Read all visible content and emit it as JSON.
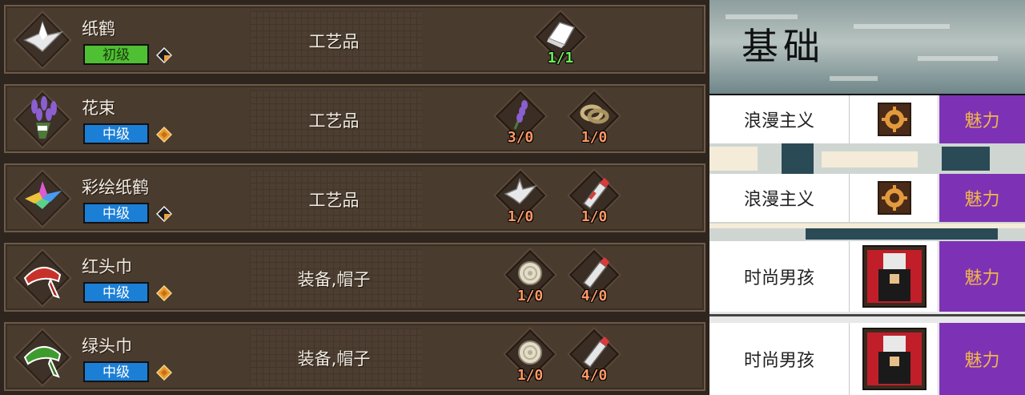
{
  "recipes": [
    {
      "name": "纸鹤",
      "level": "初级",
      "level_type": "basic",
      "category": "工艺品",
      "item_icon": "paper-crane-icon",
      "tag_icon": "black-gold-diamond-icon",
      "materials": [
        {
          "icon": "paper-icon",
          "count": "1/1",
          "ok": true
        }
      ]
    },
    {
      "name": "花束",
      "level": "中级",
      "level_type": "mid",
      "category": "工艺品",
      "item_icon": "lavender-bouquet-icon",
      "tag_icon": "orange-diamond-icon",
      "materials": [
        {
          "icon": "lavender-icon",
          "count": "3/0",
          "ok": false
        },
        {
          "icon": "rope-icon",
          "count": "1/0",
          "ok": false
        }
      ]
    },
    {
      "name": "彩绘纸鹤",
      "level": "中级",
      "level_type": "mid",
      "category": "工艺品",
      "item_icon": "rainbow-crane-icon",
      "tag_icon": "black-gold-diamond-icon",
      "materials": [
        {
          "icon": "paper-crane-icon",
          "count": "1/0",
          "ok": false
        },
        {
          "icon": "paint-tube-icon",
          "count": "1/0",
          "ok": false
        }
      ]
    },
    {
      "name": "红头巾",
      "level": "中级",
      "level_type": "mid",
      "category": "装备,帽子",
      "item_icon": "red-bandana-icon",
      "tag_icon": "orange-diamond-icon",
      "materials": [
        {
          "icon": "cloth-roll-icon",
          "count": "1/0",
          "ok": false
        },
        {
          "icon": "paint-tube-icon",
          "count": "4/0",
          "ok": false
        }
      ]
    },
    {
      "name": "绿头巾",
      "level": "中级",
      "level_type": "mid",
      "category": "装备,帽子",
      "item_icon": "green-bandana-icon",
      "tag_icon": "orange-diamond-icon",
      "materials": [
        {
          "icon": "cloth-roll-icon",
          "count": "1/0",
          "ok": false
        },
        {
          "icon": "paint-tube-icon",
          "count": "4/0",
          "ok": false
        }
      ]
    }
  ],
  "side": {
    "title": "基础",
    "rows": [
      {
        "name": "浪漫主义",
        "icon": "romance-gear-icon",
        "attr": "魅力"
      },
      {
        "name": "浪漫主义",
        "icon": "romance-gear-icon",
        "attr": "魅力"
      },
      {
        "name": "时尚男孩",
        "icon": "fashion-boy-portrait-icon",
        "attr": "魅力"
      },
      {
        "name": "时尚男孩",
        "icon": "fashion-boy-portrait-icon",
        "attr": "魅力"
      }
    ]
  },
  "colors": {
    "basic_level": "#4fbf33",
    "mid_level": "#1c7fd6",
    "attr_bg": "#7d32b5",
    "attr_text": "#f1b64a",
    "count_missing": "#ff9966",
    "count_ok": "#6ef05a"
  }
}
